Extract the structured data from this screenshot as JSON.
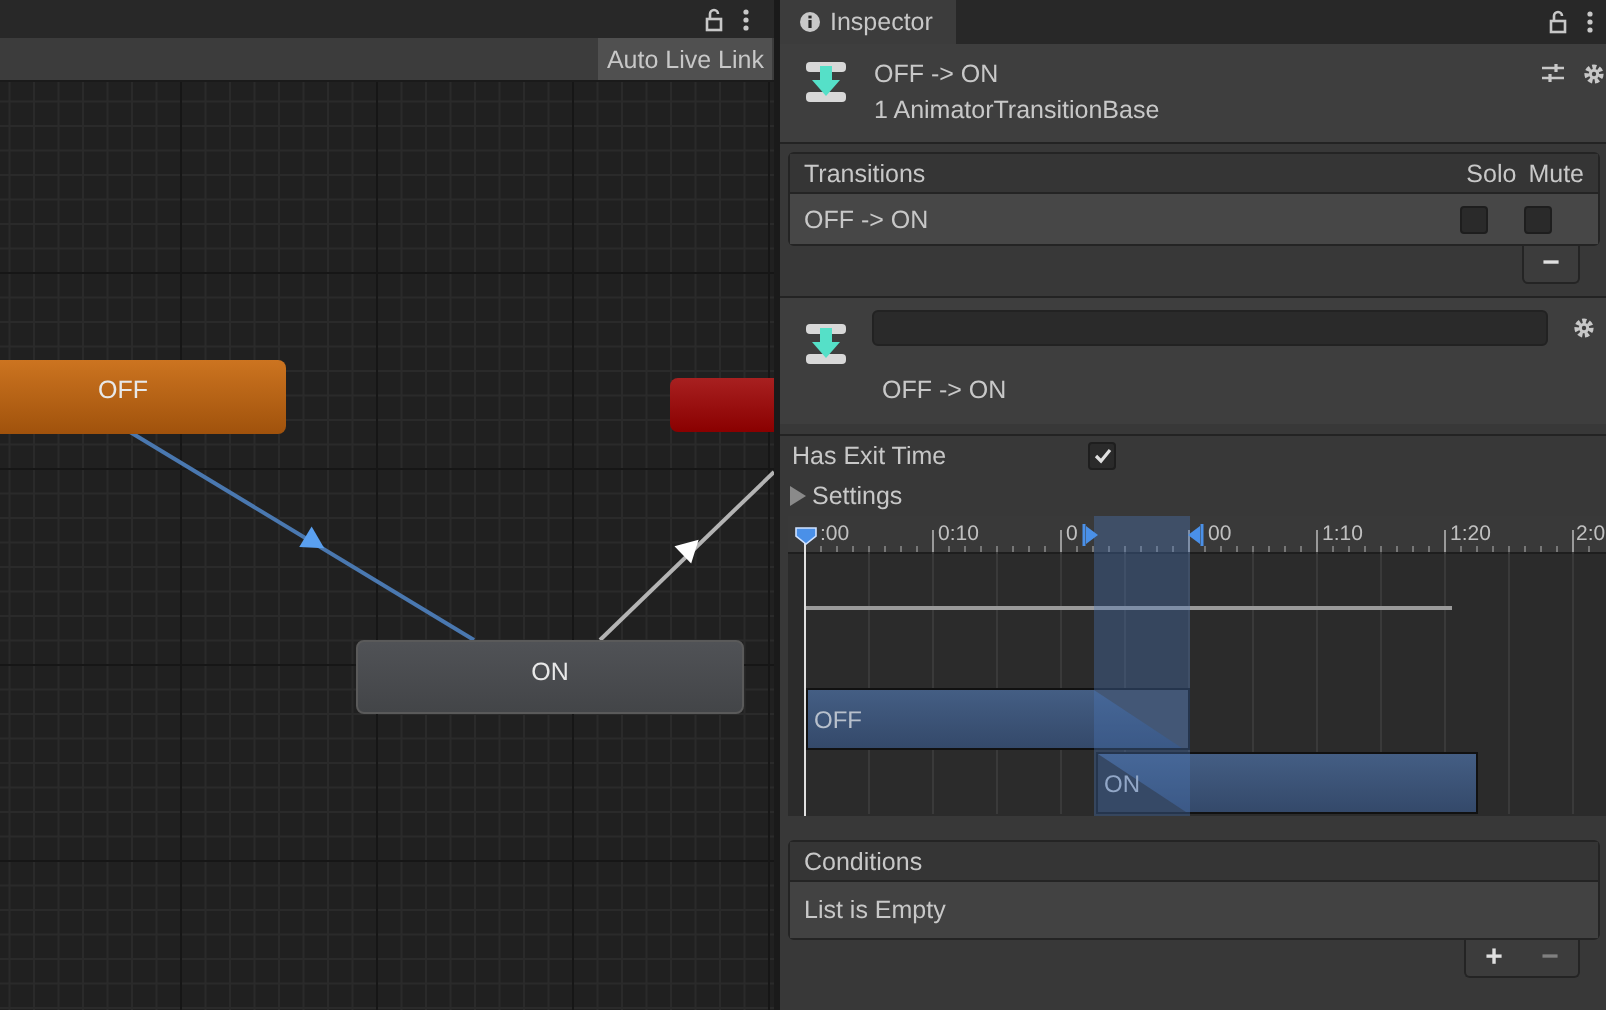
{
  "graph_panel": {
    "toolbar": {
      "live_link_button": "Auto Live Link"
    },
    "nodes": [
      {
        "label": "OFF",
        "kind": "default"
      },
      {
        "label": "ON",
        "kind": "normal"
      },
      {
        "kind": "exit"
      }
    ],
    "transitions": [
      {
        "selected": true
      },
      {
        "selected": false
      }
    ]
  },
  "inspector": {
    "tabs": [
      {
        "label": "Inspector",
        "selected": true
      }
    ],
    "header": {
      "title": "OFF -> ON",
      "subtitle": "1 AnimatorTransitionBase"
    },
    "transitions": {
      "columns": [
        "Transitions",
        "Solo",
        "Mute"
      ],
      "rows": [
        {
          "name": "OFF -> ON",
          "solo": false,
          "mute": false
        }
      ],
      "remove_button": "−"
    },
    "transition": {
      "name_label": "OFF -> ON",
      "has_exit_time": {
        "label": "Has Exit Time",
        "checked": true
      },
      "settings": {
        "label": "Settings",
        "expanded": false
      }
    },
    "timeline": {
      "ruler": [
        ":00",
        "0:10",
        "0",
        "00",
        "1:10",
        "1:20",
        "2:0"
      ],
      "bars": [
        {
          "label": "OFF"
        },
        {
          "label": "ON"
        }
      ]
    },
    "conditions": {
      "title": "Conditions",
      "empty_text": "List is Empty",
      "add_button": "+",
      "remove_button": "−"
    }
  }
}
